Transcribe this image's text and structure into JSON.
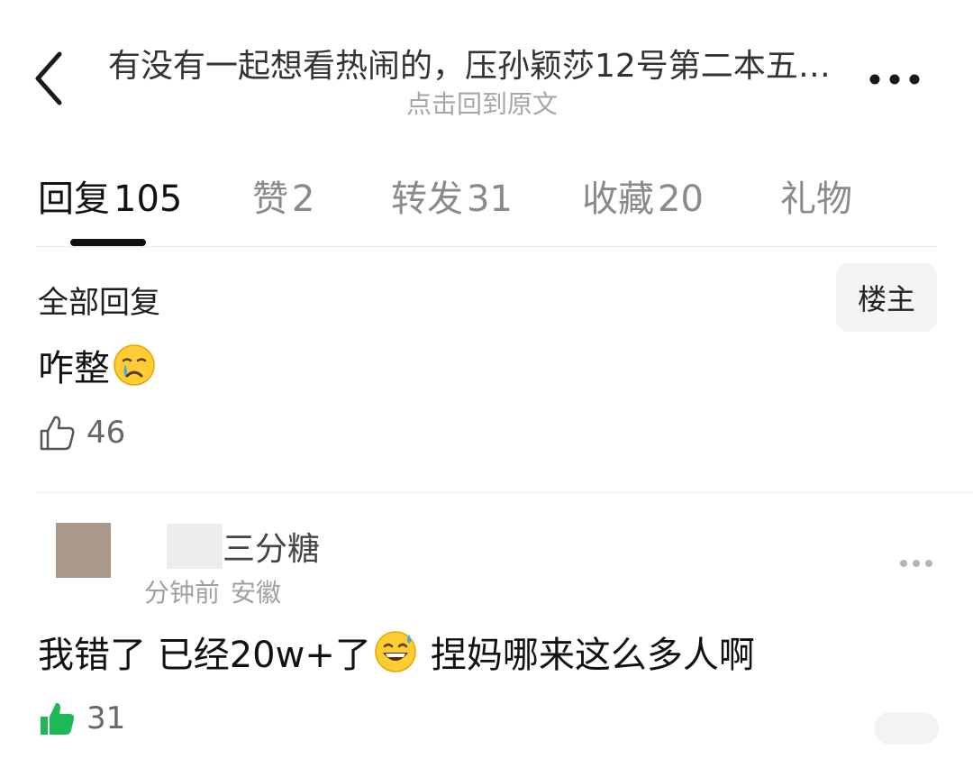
{
  "header": {
    "back_icon": "chevron-left-icon",
    "title": "有没有一起想看热闹的，压孙颖莎12号第二本五大…",
    "subtitle": "点击回到原文",
    "more_icon": "more-horizontal-icon"
  },
  "tabs": [
    {
      "label": "回复",
      "count": "105",
      "active": true
    },
    {
      "label": "赞",
      "count": "2",
      "active": false
    },
    {
      "label": "转发",
      "count": "31",
      "active": false
    },
    {
      "label": "收藏",
      "count": "20",
      "active": false
    },
    {
      "label": "礼物",
      "count": "",
      "active": false
    }
  ],
  "filter": {
    "section_title": "全部回复",
    "op_only_button": "楼主"
  },
  "comments": [
    {
      "text": "咋整",
      "emoji": "crying-face-emoji",
      "likes": "46",
      "liked": false
    },
    {
      "username": "三分糖",
      "time": "分钟前",
      "location": "安徽",
      "text_part1": "我错了 已经20w+了",
      "emoji": "grinning-sweat-emoji",
      "text_part2": "捏妈哪来这么多人啊",
      "likes": "31",
      "liked": true
    }
  ],
  "colors": {
    "text_primary": "#111111",
    "text_secondary": "#8a8a8a",
    "meta": "#a0a0a0",
    "like_active": "#1db954",
    "divider": "#e8e8e8"
  }
}
